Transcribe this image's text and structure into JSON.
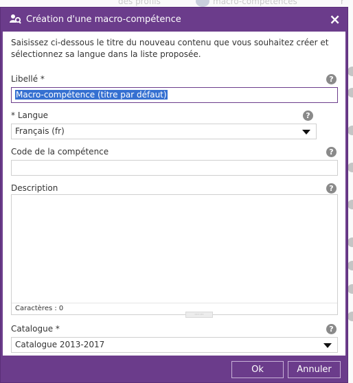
{
  "background": {
    "tabs": [
      "des profils",
      "macro-compétences",
      "r"
    ]
  },
  "dialog": {
    "title": "Création d'une macro-compétence",
    "close_label": "×",
    "intro": "Saisissez ci-dessous le titre du nouveau contenu que vous souhaitez créer et sélectionnez sa langue dans la liste proposée.",
    "help_glyph": "?",
    "fields": {
      "libelle": {
        "label": "Libellé *",
        "value": "Macro-compétence (titre par défaut)"
      },
      "langue": {
        "label": "* Langue",
        "value": "Français (fr)"
      },
      "code": {
        "label": "Code de la compétence",
        "value": ""
      },
      "description": {
        "label": "Description",
        "value": "",
        "counter": "Caractères : 0"
      },
      "catalogue": {
        "label": "Catalogue *",
        "value": "Catalogue 2013-2017"
      }
    },
    "buttons": {
      "ok": "Ok",
      "cancel": "Annuler"
    }
  },
  "colors": {
    "accent": "#6b3c8b",
    "selection": "#3570d1",
    "help": "#8a8a8a"
  }
}
